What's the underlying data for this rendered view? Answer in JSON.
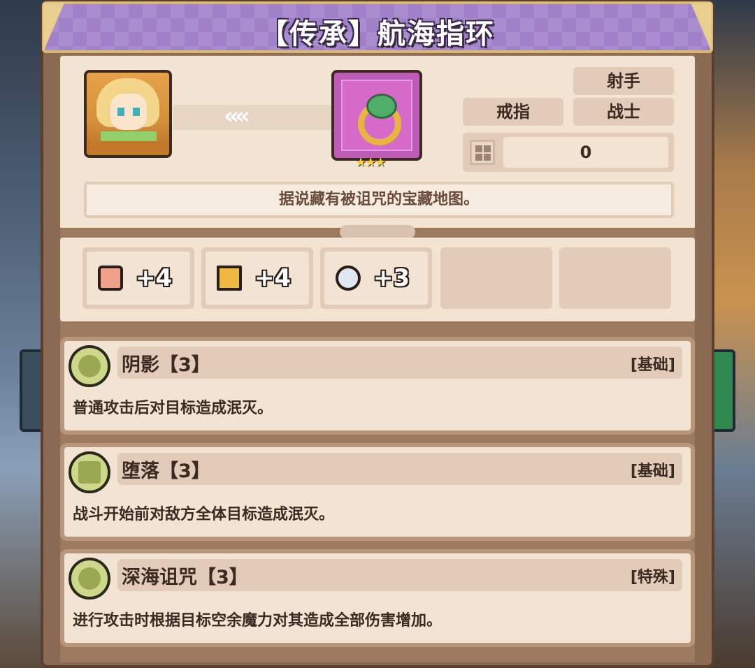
{
  "title": "【传承】航海指环",
  "item": {
    "portrait_icon": "hero-portrait",
    "arrows": "‹‹‹‹",
    "item_icon": "ring-icon",
    "stars": "★★★",
    "tags": {
      "shooter": "射手",
      "ring": "戒指",
      "warrior": "战士"
    },
    "slot_value": "0",
    "description": "据说藏有被诅咒的宝藏地图。"
  },
  "stats": [
    {
      "icon": "fist-icon",
      "value": "+4"
    },
    {
      "icon": "boot-icon",
      "value": "+4"
    },
    {
      "icon": "feather-icon",
      "value": "+3"
    }
  ],
  "skills": [
    {
      "icon": "moon-icon",
      "name": "阴影【3】",
      "kind": "[基础]",
      "text": "普通攻击后对目标造成泯灭。"
    },
    {
      "icon": "square-rune-icon",
      "name": "堕落【3】",
      "kind": "[基础]",
      "text": "战斗开始前对敌方全体目标造成泯灭。"
    },
    {
      "icon": "flame-rune-icon",
      "name": "深海诅咒【3】",
      "kind": "[特殊]",
      "text": "进行攻击时根据目标空余魔力对其造成全部伤害增加。"
    }
  ]
}
